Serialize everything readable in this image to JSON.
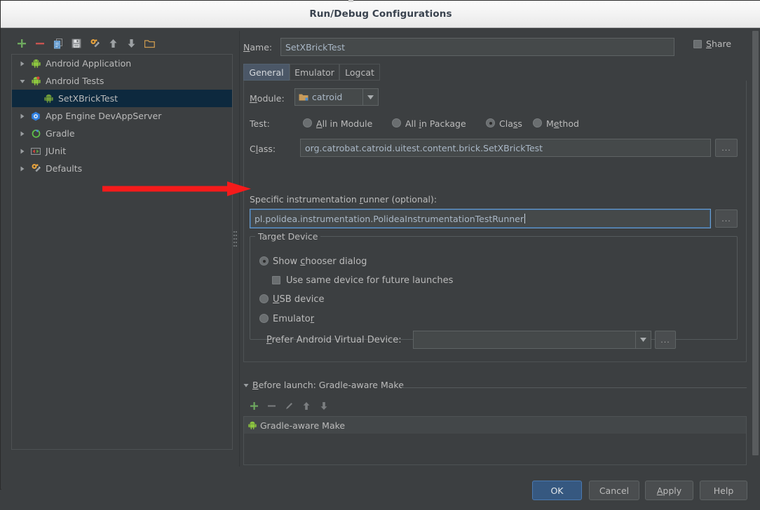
{
  "window": {
    "title": "Run/Debug Configurations"
  },
  "tree_toolbar": {
    "items": [
      {
        "name": "add-icon",
        "label": "Add New Configuration"
      },
      {
        "name": "remove-icon",
        "label": "Remove Configuration"
      },
      {
        "name": "copy-icon",
        "label": "Copy Configuration"
      },
      {
        "name": "save-icon",
        "label": "Save Configuration"
      },
      {
        "name": "edit-defaults-icon",
        "label": "Edit defaults"
      },
      {
        "name": "move-up-icon",
        "label": "Move Up"
      },
      {
        "name": "move-down-icon",
        "label": "Move Down"
      },
      {
        "name": "folder-icon",
        "label": "Create New Folder"
      }
    ]
  },
  "tree": {
    "items": [
      {
        "label": "Android Application",
        "icon": "android-icon",
        "expandable": true,
        "expanded": false,
        "indent": false,
        "selected": false
      },
      {
        "label": "Android Tests",
        "icon": "android-test-icon",
        "expandable": true,
        "expanded": true,
        "indent": false,
        "selected": false
      },
      {
        "label": "SetXBrickTest",
        "icon": "android-test-icon",
        "expandable": false,
        "expanded": false,
        "indent": true,
        "selected": true
      },
      {
        "label": "App Engine DevAppServer",
        "icon": "app-engine-icon",
        "expandable": true,
        "expanded": false,
        "indent": false,
        "selected": false
      },
      {
        "label": "Gradle",
        "icon": "gradle-icon",
        "expandable": true,
        "expanded": false,
        "indent": false,
        "selected": false
      },
      {
        "label": "JUnit",
        "icon": "junit-icon",
        "expandable": true,
        "expanded": false,
        "indent": false,
        "selected": false
      },
      {
        "label": "Defaults",
        "icon": "defaults-icon",
        "expandable": true,
        "expanded": false,
        "indent": false,
        "selected": false
      }
    ]
  },
  "form": {
    "name_label": "Name:",
    "name_label_mnemonic": "N",
    "name_value": "SetXBrickTest",
    "share_label": "Share",
    "share_mnemonic": "S",
    "share_checked": false
  },
  "tabs": [
    {
      "label": "General",
      "active": true
    },
    {
      "label": "Emulator",
      "active": false
    },
    {
      "label": "Logcat",
      "active": false
    }
  ],
  "general": {
    "module_label": "Module:",
    "module_mnemonic": "M",
    "module_value": "catroid",
    "test_label": "Test:",
    "test_options": [
      {
        "label": "All in Module",
        "mnemonic": "A",
        "selected": false
      },
      {
        "label": "All in Package",
        "mnemonic": "i",
        "selected": false
      },
      {
        "label": "Class",
        "mnemonic": "s",
        "selected": true
      },
      {
        "label": "Method",
        "mnemonic": "e",
        "selected": false
      }
    ],
    "class_label": "Class:",
    "class_mnemonic": "l",
    "class_value": "org.catrobat.catroid.uitest.content.brick.SetXBrickTest",
    "class_browse_label": "...",
    "runner_label": "Specific instrumentation runner (optional):",
    "runner_mnemonic": "r",
    "runner_value": "pl.polidea.instrumentation.PolideaInstrumentationTestRunner",
    "runner_browse_label": "..."
  },
  "target_device": {
    "title": "Target Device",
    "options": [
      {
        "label": "Show chooser dialog",
        "mnemonic": "c",
        "selected": true
      },
      {
        "label": "USB device",
        "mnemonic": "U",
        "selected": false
      },
      {
        "label": "Emulator",
        "mnemonic": "r",
        "selected": false
      }
    ],
    "same_device_label": "Use same device for future launches",
    "same_device_checked": false,
    "avd_label": "Prefer Android Virtual Device:",
    "avd_mnemonic": "P",
    "avd_value": "",
    "avd_browse_label": "..."
  },
  "before_launch": {
    "header": "Before launch: Gradle-aware Make",
    "header_mnemonic": "B",
    "expanded": true,
    "toolbar": [
      {
        "name": "add-task-icon",
        "label": "Add"
      },
      {
        "name": "remove-task-icon",
        "label": "Remove"
      },
      {
        "name": "edit-task-icon",
        "label": "Edit"
      },
      {
        "name": "move-task-up-icon",
        "label": "Move Up"
      },
      {
        "name": "move-task-down-icon",
        "label": "Move Down"
      }
    ],
    "tasks": [
      {
        "label": "Gradle-aware Make",
        "icon": "android-icon"
      }
    ]
  },
  "buttons": [
    {
      "label": "OK",
      "default": true,
      "mnemonic": ""
    },
    {
      "label": "Cancel",
      "default": false,
      "mnemonic": ""
    },
    {
      "label": "Apply",
      "default": false,
      "mnemonic": "A"
    },
    {
      "label": "Help",
      "default": false,
      "mnemonic": ""
    }
  ],
  "annotation": {
    "arrow_color": "#f51b1b",
    "points_to": "Specific instrumentation runner field"
  },
  "colors": {
    "background": "#3c3f41",
    "field_background": "#45494a",
    "text": "#bbbbbb",
    "value_text": "#a9b7c6",
    "selection": "#0d293e",
    "default_button": "#365880",
    "accent_focus": "#6b9ed0"
  }
}
